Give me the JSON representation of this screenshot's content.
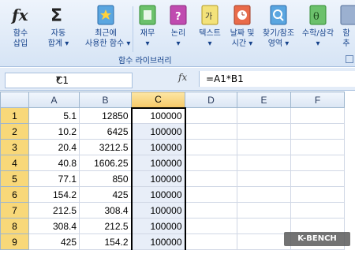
{
  "ribbon": {
    "buttons": [
      {
        "line1": "함수",
        "line2": "삽입",
        "icon": "fx-icon"
      },
      {
        "line1": "자동",
        "line2": "합계 ▾",
        "icon": "sigma-icon"
      },
      {
        "line1": "최근에",
        "line2": "사용한 함수 ▾",
        "icon": "recent-book-icon"
      },
      {
        "line1": "재무",
        "line2": "▾",
        "icon": "finance-book-icon"
      },
      {
        "line1": "논리",
        "line2": "▾",
        "icon": "logic-book-icon"
      },
      {
        "line1": "텍스트",
        "line2": "▾",
        "icon": "text-book-icon"
      },
      {
        "line1": "날짜 및",
        "line2": "시간 ▾",
        "icon": "datetime-book-icon"
      },
      {
        "line1": "찾기/참조",
        "line2": "영역 ▾",
        "icon": "lookup-book-icon"
      },
      {
        "line1": "수학/삼각",
        "line2": "▾",
        "icon": "math-book-icon"
      },
      {
        "line1": "함",
        "line2": "추",
        "icon": "more-book-icon"
      }
    ],
    "group_label": "함수 라이브러리"
  },
  "formula_bar": {
    "name_box": "C1",
    "fx": "fx",
    "formula": "=A1*B1"
  },
  "columns": [
    "A",
    "B",
    "C",
    "D",
    "E",
    "F"
  ],
  "rows": [
    {
      "num": "1",
      "a": "5.1",
      "b": "12850",
      "c": "100000"
    },
    {
      "num": "2",
      "a": "10.2",
      "b": "6425",
      "c": "100000"
    },
    {
      "num": "3",
      "a": "20.4",
      "b": "3212.5",
      "c": "100000"
    },
    {
      "num": "4",
      "a": "40.8",
      "b": "1606.25",
      "c": "100000"
    },
    {
      "num": "5",
      "a": "77.1",
      "b": "850",
      "c": "100000"
    },
    {
      "num": "6",
      "a": "154.2",
      "b": "425",
      "c": "100000"
    },
    {
      "num": "7",
      "a": "212.5",
      "b": "308.4",
      "c": "100000"
    },
    {
      "num": "8",
      "a": "308.4",
      "b": "212.5",
      "c": "100000"
    },
    {
      "num": "9",
      "a": "425",
      "b": "154.2",
      "c": "100000"
    }
  ],
  "watermark": "K-BENCH",
  "colors": {
    "accent": "#15428b",
    "selection": "#f8d879"
  }
}
